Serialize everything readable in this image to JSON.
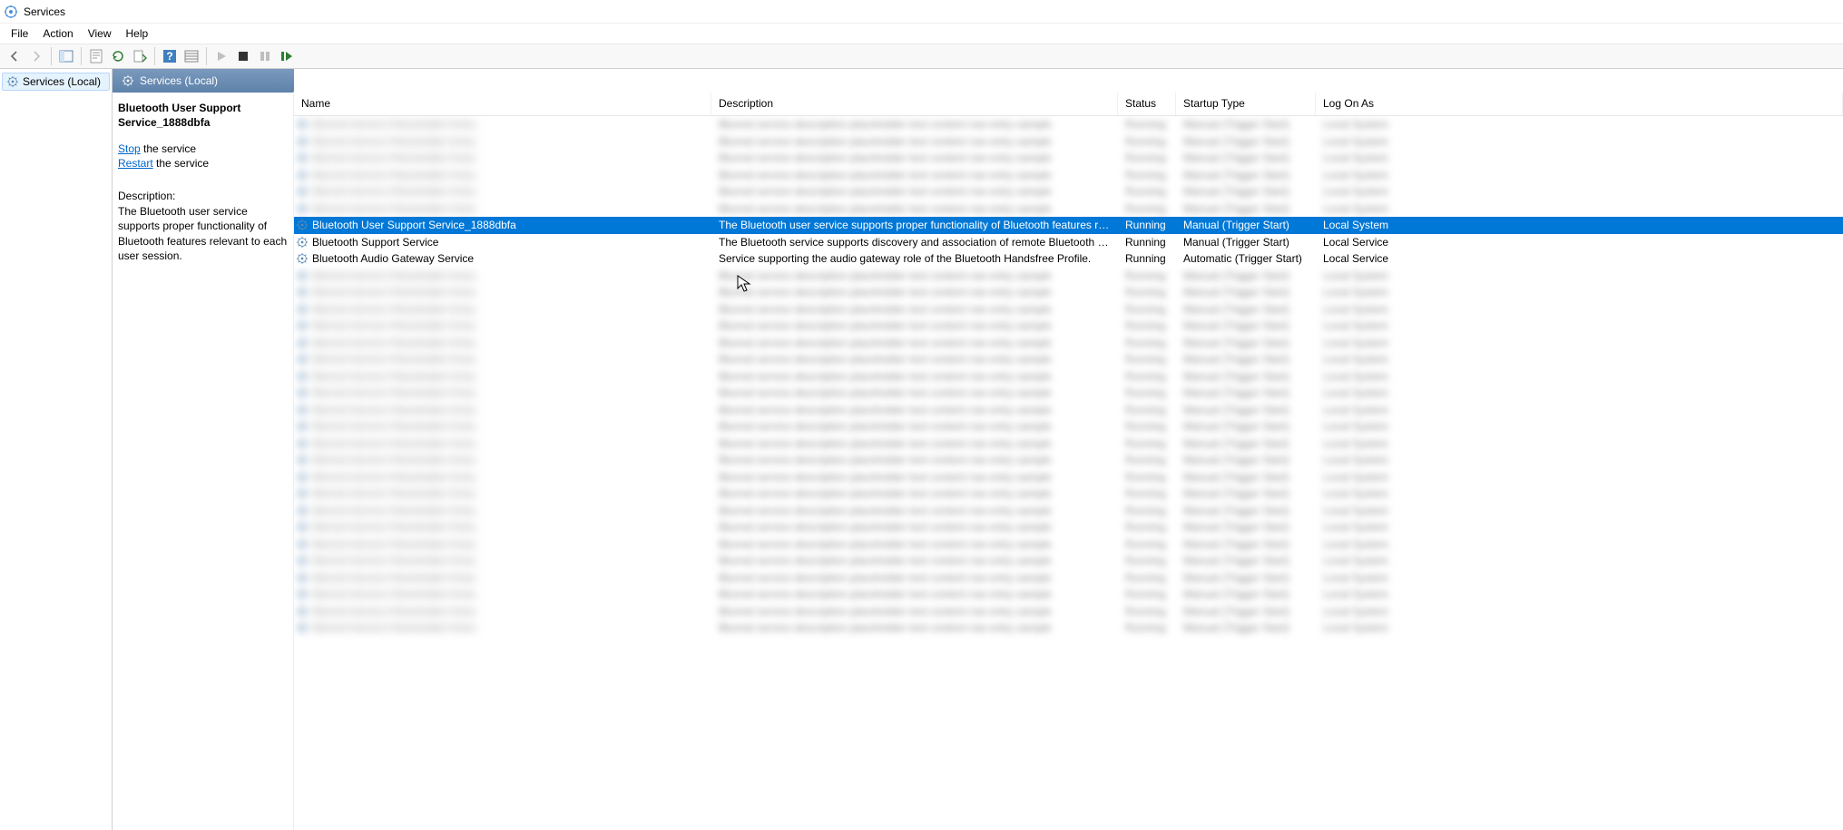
{
  "window": {
    "title": "Services"
  },
  "menu": {
    "file": "File",
    "action": "Action",
    "view": "View",
    "help": "Help"
  },
  "tree": {
    "root": "Services (Local)"
  },
  "panel_header": "Services (Local)",
  "detail": {
    "selected_title": "Bluetooth User Support Service_1888dbfa",
    "stop_link": "Stop",
    "stop_suffix": " the service",
    "restart_link": "Restart",
    "restart_suffix": " the service",
    "desc_label": "Description:",
    "desc_text": "The Bluetooth user service supports proper functionality of Bluetooth features relevant to each user session."
  },
  "columns": {
    "name": "Name",
    "description": "Description",
    "status": "Status",
    "startup": "Startup Type",
    "logon": "Log On As"
  },
  "services_visible": [
    {
      "name": "Bluetooth User Support Service_1888dbfa",
      "description": "The Bluetooth user service supports proper functionality of Bluetooth features releva...",
      "status": "Running",
      "startup": "Manual (Trigger Start)",
      "logon": "Local System",
      "selected": true
    },
    {
      "name": "Bluetooth Support Service",
      "description": "The Bluetooth service supports discovery and association of remote Bluetooth device...",
      "status": "Running",
      "startup": "Manual (Trigger Start)",
      "logon": "Local Service",
      "selected": false
    },
    {
      "name": "Bluetooth Audio Gateway Service",
      "description": "Service supporting the audio gateway role of the Bluetooth Handsfree Profile.",
      "status": "Running",
      "startup": "Automatic (Trigger Start)",
      "logon": "Local Service",
      "selected": false
    }
  ],
  "blur_rows_before": 6,
  "blur_rows_after": 22,
  "blur_placeholder": {
    "name": "Blurred Service Placeholder Entry",
    "description": "Blurred service description placeholder text content row entry sample",
    "status": "Running",
    "startup": "Manual (Trigger Start)",
    "logon": "Local System"
  }
}
